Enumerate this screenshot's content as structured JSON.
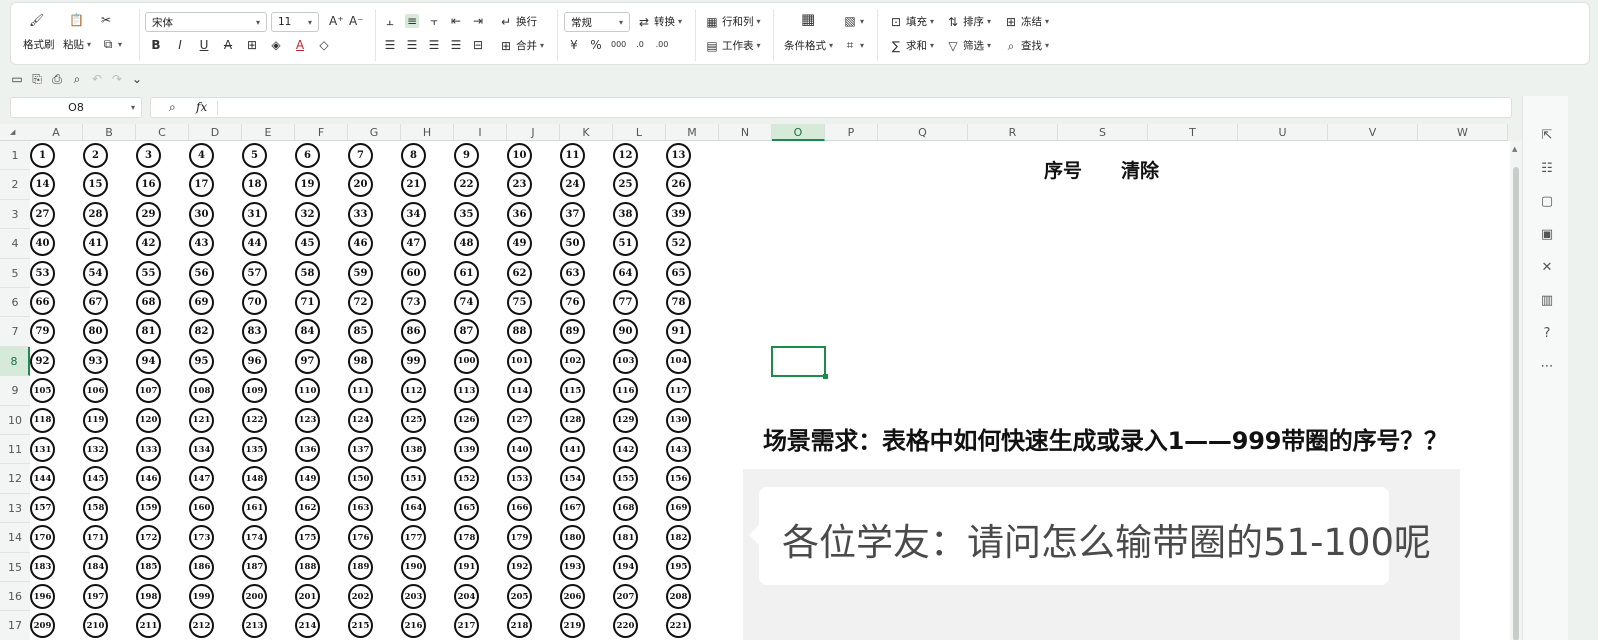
{
  "ribbon": {
    "format_painter": "格式刷",
    "paste": "粘贴",
    "font_name": "宋体",
    "font_size": "11",
    "wrap": "换行",
    "merge": "合并",
    "number_format": "常规",
    "convert": "转换",
    "rows_cols": "行和列",
    "worksheet": "工作表",
    "cond_format": "条件格式",
    "fill": "填充",
    "sort": "排序",
    "freeze": "冻结",
    "sum": "求和",
    "filter": "筛选",
    "find": "查找"
  },
  "name_box": "O8",
  "fx": "fx",
  "columns": [
    "A",
    "B",
    "C",
    "D",
    "E",
    "F",
    "G",
    "H",
    "I",
    "J",
    "K",
    "L",
    "M",
    "N",
    "O",
    "P",
    "Q",
    "R",
    "S",
    "T",
    "U",
    "V",
    "W"
  ],
  "rows": [
    "1",
    "2",
    "3",
    "4",
    "5",
    "6",
    "7",
    "8",
    "9",
    "10",
    "11",
    "12",
    "13",
    "14",
    "15",
    "16",
    "17"
  ],
  "active_column": "O",
  "active_row": "8",
  "circled_numbers": {
    "start": 1,
    "end": 221,
    "per_row": 13
  },
  "header_labels": {
    "seq": "序号",
    "clear": "清除"
  },
  "scenario_text": "场景需求：表格中如何快速生成或录入1——999带圈的序号？？",
  "question_text": "各位学友：请问怎么输带圈的51-100呢",
  "colors": {
    "accent": "#1d8c4a",
    "grid_bg": "#ffffff",
    "chrome_bg": "#eef2ef"
  }
}
